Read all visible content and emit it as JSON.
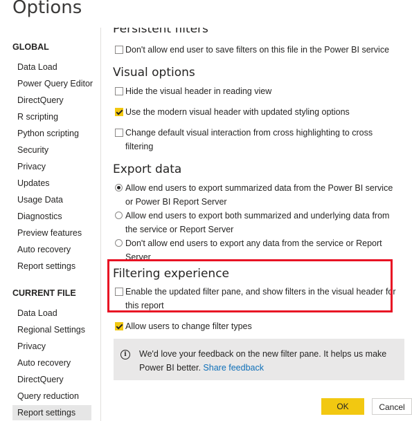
{
  "window": {
    "title": "Options"
  },
  "nav": {
    "global_heading": "GLOBAL",
    "global_items": [
      "Data Load",
      "Power Query Editor",
      "DirectQuery",
      "R scripting",
      "Python scripting",
      "Security",
      "Privacy",
      "Updates",
      "Usage Data",
      "Diagnostics",
      "Preview features",
      "Auto recovery",
      "Report settings"
    ],
    "current_heading": "CURRENT FILE",
    "current_items": [
      "Data Load",
      "Regional Settings",
      "Privacy",
      "Auto recovery",
      "DirectQuery",
      "Query reduction",
      "Report settings"
    ],
    "selected": "Report settings"
  },
  "content": {
    "persistent_filters": {
      "heading": "Persistent filters",
      "option": "Don't allow end user to save filters on this file in the Power BI service",
      "checked": false
    },
    "visual_options": {
      "heading": "Visual options",
      "options": [
        {
          "label": "Hide the visual header in reading view",
          "checked": false
        },
        {
          "label": "Use the modern visual header with updated styling options",
          "checked": true
        },
        {
          "label": "Change default visual interaction from cross highlighting to cross filtering",
          "checked": false
        }
      ]
    },
    "export_data": {
      "heading": "Export data",
      "options": [
        {
          "label": "Allow end users to export summarized data from the Power BI service or Power BI Report Server",
          "selected": true
        },
        {
          "label": "Allow end users to export both summarized and underlying data from the service or Report Server",
          "selected": false
        },
        {
          "label": "Don't allow end users to export any data from the service or Report Server",
          "selected": false
        }
      ]
    },
    "filtering_experience": {
      "heading": "Filtering experience",
      "options": [
        {
          "label": "Enable the updated filter pane, and show filters in the visual header for this report",
          "checked": false
        },
        {
          "label": "Allow users to change filter types",
          "checked": true
        }
      ]
    },
    "info": {
      "text": "We'd love your feedback on the new filter pane. It helps us make Power BI better.",
      "link": "Share feedback"
    }
  },
  "buttons": {
    "ok": "OK",
    "cancel": "Cancel"
  },
  "colors": {
    "accent": "#f2c811",
    "highlight_box": "#e81123",
    "link": "#0e6fb8"
  }
}
